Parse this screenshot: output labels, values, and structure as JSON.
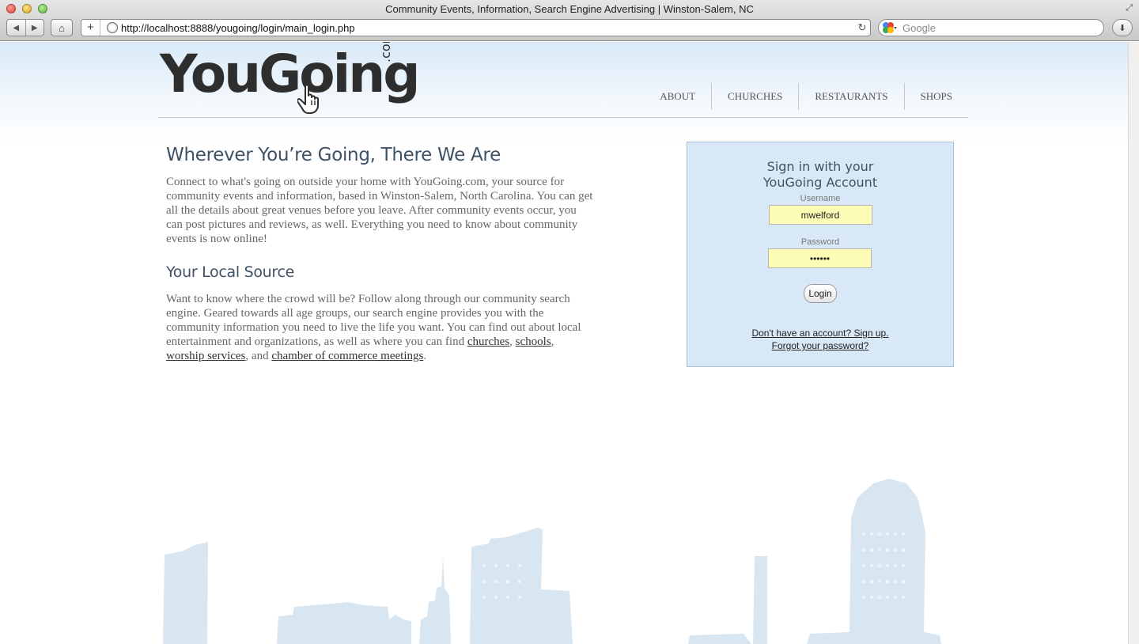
{
  "window": {
    "title": "Community Events, Information, Search Engine Advertising | Winston-Salem, NC"
  },
  "toolbar": {
    "back_icon": "◀",
    "forward_icon": "▶",
    "home_icon": "⌂",
    "plus_icon": "+",
    "url": "http://localhost:8888/yougoing/login/main_login.php",
    "reload_icon": "↻",
    "search_placeholder": "Google",
    "download_icon": "⬇"
  },
  "logo": {
    "text": "YouGoing",
    "suffix": ".com"
  },
  "nav": {
    "items": [
      "ABOUT",
      "CHURCHES",
      "RESTAURANTS",
      "SHOPS"
    ]
  },
  "main": {
    "heading": "Wherever You’re Going, There We Are",
    "intro": "Connect to what's going on outside your home with YouGoing.com, your source for community events and information, based in Winston-Salem, North Carolina. You can get all the details about great venues before you leave. After community events occur, you can post pictures and reviews, as well. Everything you need to know about community events is now online!",
    "subheading": "Your Local Source",
    "body_start": "Want to know where the crowd will be? Follow along through our community search engine. Geared towards all age groups, our search engine provides you with the community information you need to live the life you want. You can find out about local entertainment and organizations, as well as where you can find ",
    "link_churches": "churches",
    "sep1": ", ",
    "link_schools": "schools",
    "sep2": ", ",
    "link_worship": "worship services",
    "sep3": ", and ",
    "link_chamber": "chamber of commerce meetings",
    "end": "."
  },
  "login": {
    "title_line1": "Sign in with your",
    "title_line2": "YouGoing Account",
    "username_label": "Username",
    "username_value": "mwelford",
    "password_label": "Password",
    "password_value": "••••••",
    "login_button": "Login",
    "signup_link": "Don't have an account? Sign up.",
    "forgot_link": "Forgot your password?"
  },
  "colors": {
    "heading": "#3e5266",
    "login_bg": "#d9e8f6",
    "input_bg": "#fefdb5",
    "skyline": "#d8e6f2"
  }
}
